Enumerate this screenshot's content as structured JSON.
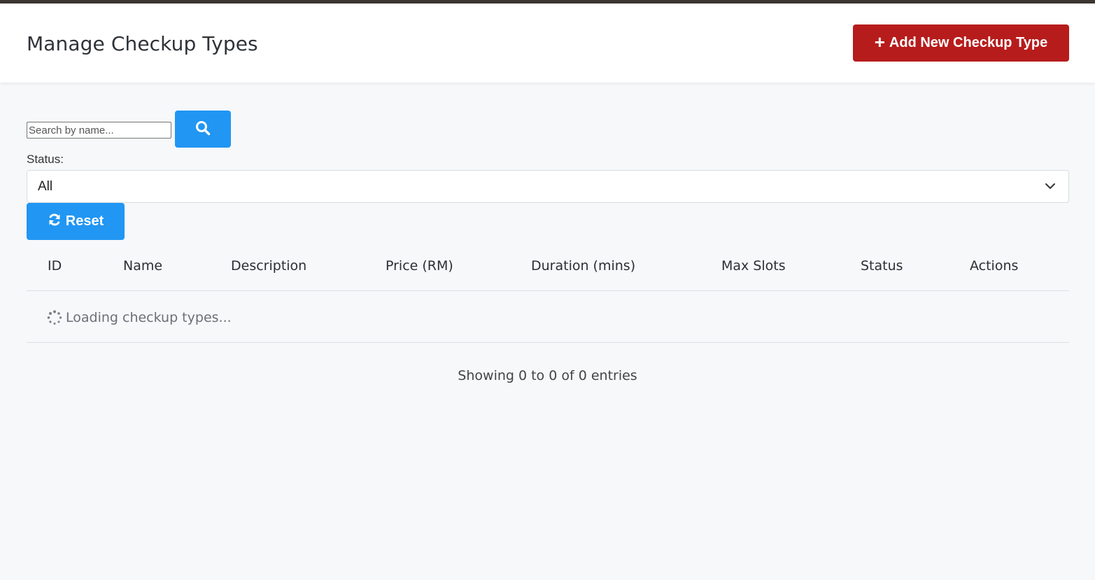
{
  "header": {
    "title": "Manage Checkup Types",
    "add_button_label": "Add New Checkup Type",
    "add_button_icon": "plus-icon"
  },
  "filters": {
    "search_placeholder": "Search by name...",
    "search_value": "",
    "search_icon": "search-icon",
    "status_label": "Status:",
    "status_value": "All",
    "reset_label": "Reset",
    "reset_icon": "refresh-icon"
  },
  "table": {
    "columns": [
      "ID",
      "Name",
      "Description",
      "Price (RM)",
      "Duration (mins)",
      "Max Slots",
      "Status",
      "Actions"
    ],
    "loading_text": "Loading checkup types..."
  },
  "pagination": {
    "info": "Showing 0 to 0 of 0 entries"
  },
  "colors": {
    "primary": "#2196f3",
    "danger": "#b71c1c",
    "background": "#f6f8fa"
  }
}
